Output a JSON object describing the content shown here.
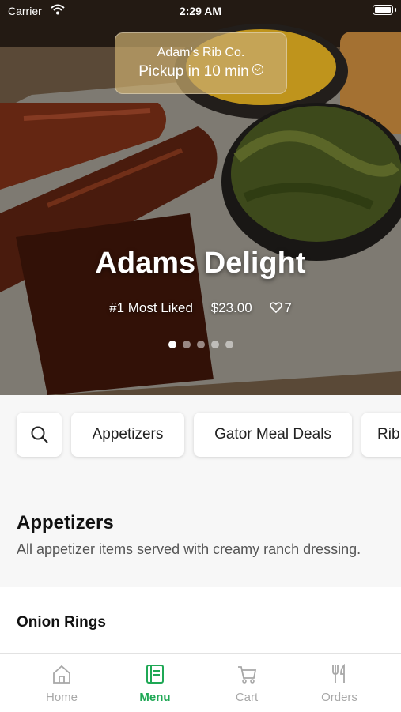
{
  "status_bar": {
    "carrier": "Carrier",
    "time": "2:29 AM"
  },
  "pickup": {
    "restaurant": "Adam's Rib Co.",
    "eta": "Pickup in 10 min"
  },
  "featured": {
    "title": "Adams Delight",
    "rank": "#1 Most Liked",
    "price": "$23.00",
    "likes": "7",
    "carousel_count": 5,
    "carousel_index": 0
  },
  "categories": [
    "Appetizers",
    "Gator Meal Deals",
    "Rib"
  ],
  "section": {
    "title": "Appetizers",
    "description": "All appetizer items served with creamy ranch dressing."
  },
  "item": {
    "name": "Onion Rings"
  },
  "tabs": [
    {
      "label": "Home",
      "icon": "home-icon"
    },
    {
      "label": "Menu",
      "icon": "menu-icon"
    },
    {
      "label": "Cart",
      "icon": "cart-icon"
    },
    {
      "label": "Orders",
      "icon": "orders-icon"
    }
  ],
  "colors": {
    "accent": "#1fa855",
    "inactive": "#a8a8a8"
  }
}
